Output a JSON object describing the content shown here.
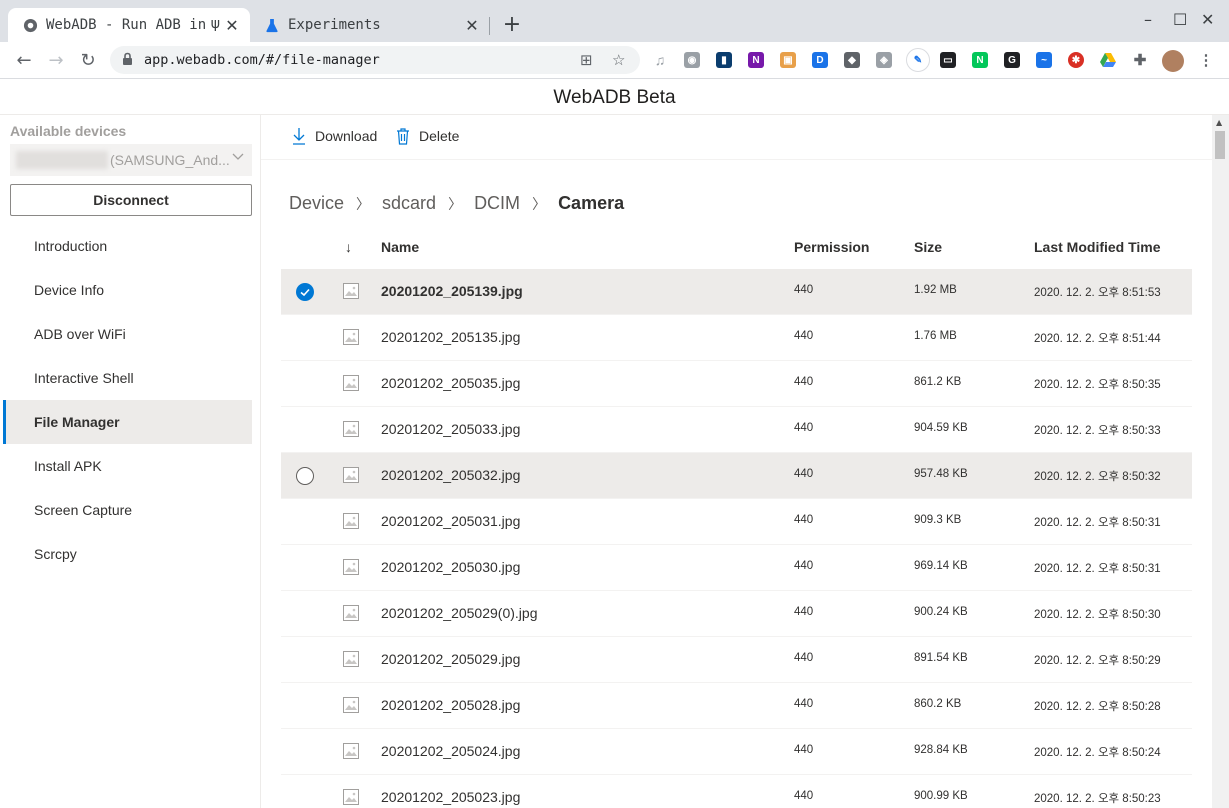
{
  "browser": {
    "tabs": [
      {
        "title": "WebADB - Run ADB in",
        "active": true
      },
      {
        "title": "Experiments",
        "active": false
      }
    ],
    "url": "app.webadb.com/#/file-manager",
    "extensions": [
      "chart-icon",
      "onenote-icon",
      "box-icon",
      "d-icon",
      "cube-icon",
      "shield-icon",
      "pen-icon",
      "pip-icon",
      "n-icon",
      "g-icon",
      "wave-icon",
      "bug-icon",
      "drive-icon",
      "puzzle-icon"
    ]
  },
  "app": {
    "title": "WebADB Beta"
  },
  "sidebar": {
    "available_label": "Available devices",
    "device_name": "(SAMSUNG_And...",
    "disconnect_label": "Disconnect",
    "items": [
      {
        "label": "Introduction",
        "selected": false
      },
      {
        "label": "Device Info",
        "selected": false
      },
      {
        "label": "ADB over WiFi",
        "selected": false
      },
      {
        "label": "Interactive Shell",
        "selected": false
      },
      {
        "label": "File Manager",
        "selected": true
      },
      {
        "label": "Install APK",
        "selected": false
      },
      {
        "label": "Screen Capture",
        "selected": false
      },
      {
        "label": "Scrcpy",
        "selected": false
      }
    ]
  },
  "commands": {
    "download": "Download",
    "delete": "Delete"
  },
  "breadcrumb": [
    "Device",
    "sdcard",
    "DCIM",
    "Camera"
  ],
  "columns": {
    "sort_glyph": "↓",
    "name": "Name",
    "permission": "Permission",
    "size": "Size",
    "modified": "Last Modified Time"
  },
  "files": [
    {
      "name": "20201202_205139.jpg",
      "permission": "440",
      "size": "1.92 MB",
      "modified": "2020. 12. 2. 오후 8:51:53",
      "state": "selected"
    },
    {
      "name": "20201202_205135.jpg",
      "permission": "440",
      "size": "1.76 MB",
      "modified": "2020. 12. 2. 오후 8:51:44",
      "state": ""
    },
    {
      "name": "20201202_205035.jpg",
      "permission": "440",
      "size": "861.2 KB",
      "modified": "2020. 12. 2. 오후 8:50:35",
      "state": ""
    },
    {
      "name": "20201202_205033.jpg",
      "permission": "440",
      "size": "904.59 KB",
      "modified": "2020. 12. 2. 오후 8:50:33",
      "state": ""
    },
    {
      "name": "20201202_205032.jpg",
      "permission": "440",
      "size": "957.48 KB",
      "modified": "2020. 12. 2. 오후 8:50:32",
      "state": "hovered"
    },
    {
      "name": "20201202_205031.jpg",
      "permission": "440",
      "size": "909.3 KB",
      "modified": "2020. 12. 2. 오후 8:50:31",
      "state": ""
    },
    {
      "name": "20201202_205030.jpg",
      "permission": "440",
      "size": "969.14 KB",
      "modified": "2020. 12. 2. 오후 8:50:31",
      "state": ""
    },
    {
      "name": "20201202_205029(0).jpg",
      "permission": "440",
      "size": "900.24 KB",
      "modified": "2020. 12. 2. 오후 8:50:30",
      "state": ""
    },
    {
      "name": "20201202_205029.jpg",
      "permission": "440",
      "size": "891.54 KB",
      "modified": "2020. 12. 2. 오후 8:50:29",
      "state": ""
    },
    {
      "name": "20201202_205028.jpg",
      "permission": "440",
      "size": "860.2 KB",
      "modified": "2020. 12. 2. 오후 8:50:28",
      "state": ""
    },
    {
      "name": "20201202_205024.jpg",
      "permission": "440",
      "size": "928.84 KB",
      "modified": "2020. 12. 2. 오후 8:50:24",
      "state": ""
    },
    {
      "name": "20201202_205023.jpg",
      "permission": "440",
      "size": "900.99 KB",
      "modified": "2020. 12. 2. 오후 8:50:23",
      "state": ""
    }
  ],
  "colors": {
    "accent": "#0078d4",
    "selected_row": "#edebe9"
  }
}
